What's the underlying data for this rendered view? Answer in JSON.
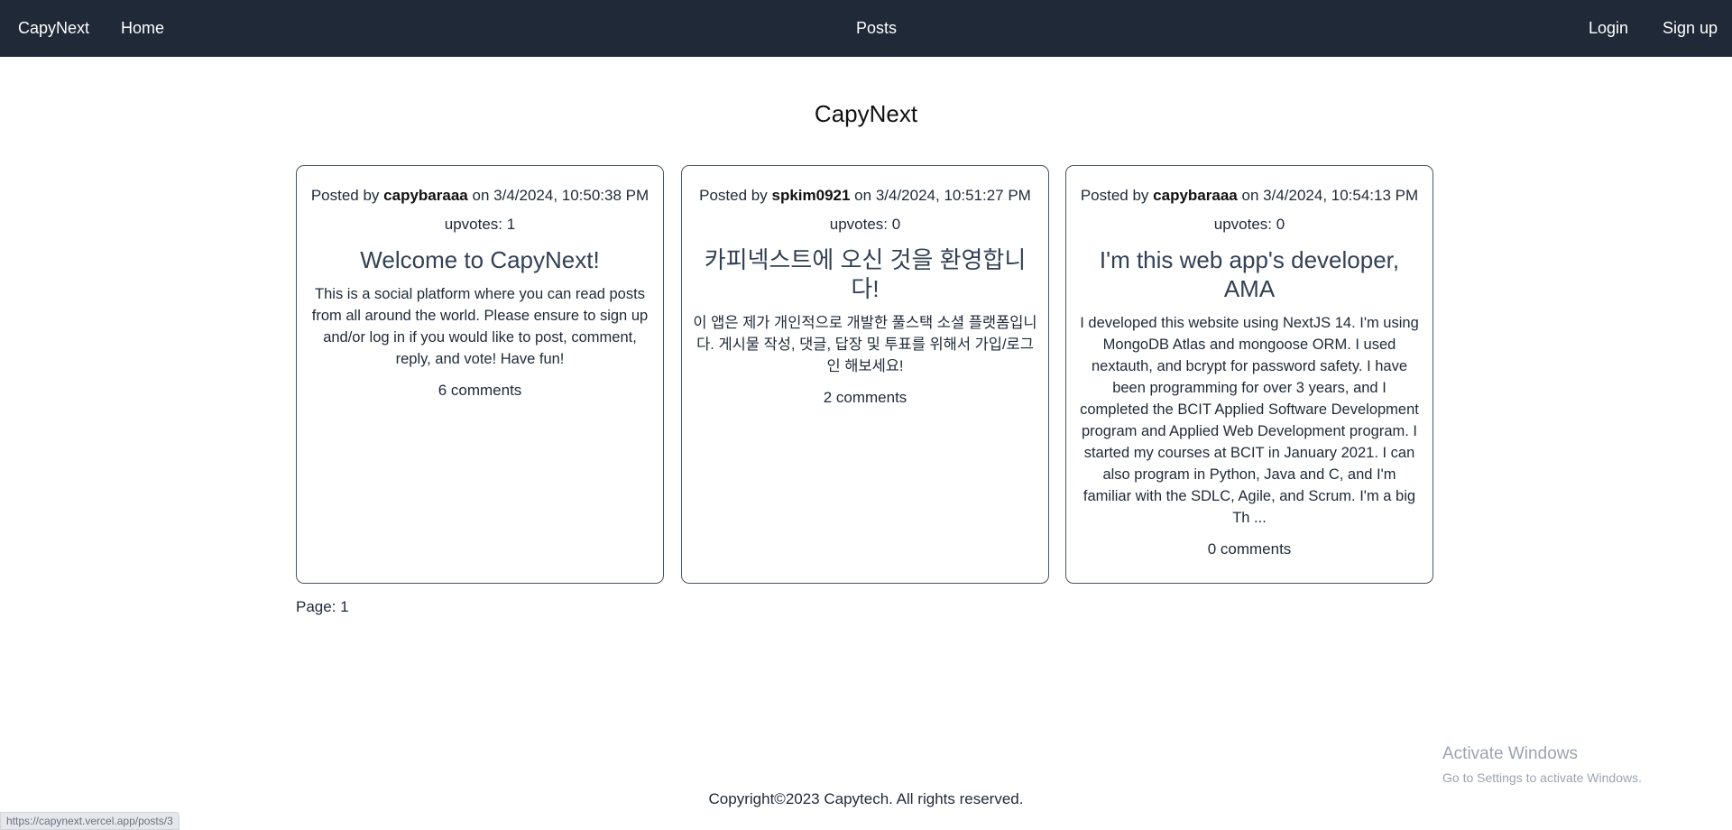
{
  "nav": {
    "brand": "CapyNext",
    "home": "Home",
    "posts": "Posts",
    "login": "Login",
    "signup": "Sign up"
  },
  "page": {
    "title": "CapyNext"
  },
  "posts": [
    {
      "prefix": "Posted by",
      "author": "capybaraaa",
      "on_label": "on",
      "date": "3/4/2024, 10:50:38 PM",
      "upvotes": "upvotes: 1",
      "title": "Welcome to CapyNext!",
      "body": "This is a social platform where you can read posts from all around the world. Please ensure to sign up and/or log in if you would like to post, comment, reply, and vote! Have fun!",
      "comments": "6 comments"
    },
    {
      "prefix": "Posted by",
      "author": "spkim0921",
      "on_label": "on",
      "date": "3/4/2024, 10:51:27 PM",
      "upvotes": "upvotes: 0",
      "title": "카피넥스트에 오신 것을 환영합니다!",
      "body": "이 앱은 제가 개인적으로 개발한 풀스택 소셜 플랫폼입니다. 게시물 작성, 댓글, 답장 및 투표를 위해서 가입/로그인 해보세요!",
      "comments": "2 comments"
    },
    {
      "prefix": "Posted by",
      "author": "capybaraaa",
      "on_label": "on",
      "date": "3/4/2024, 10:54:13 PM",
      "upvotes": "upvotes: 0",
      "title": "I'm this web app's developer, AMA",
      "body": "I developed this website using NextJS 14. I'm using MongoDB Atlas and mongoose ORM. I used nextauth, and bcrypt for password safety. I have been programming for over 3 years, and I completed the BCIT Applied Software Development program and Applied Web Development program. I started my courses at BCIT in January 2021. I can also program in Python, Java and C, and I'm familiar with the SDLC, Agile, and Scrum. I'm a big Th ...",
      "comments": "0 comments"
    }
  ],
  "pagination": {
    "label": "Page: 1"
  },
  "watermark": {
    "title": "Activate Windows",
    "subtitle": "Go to Settings to activate Windows."
  },
  "footer": {
    "copyright": "Copyright©2023 Capytech. All rights reserved."
  },
  "status_bar": {
    "url": "https://capynext.vercel.app/posts/3"
  }
}
